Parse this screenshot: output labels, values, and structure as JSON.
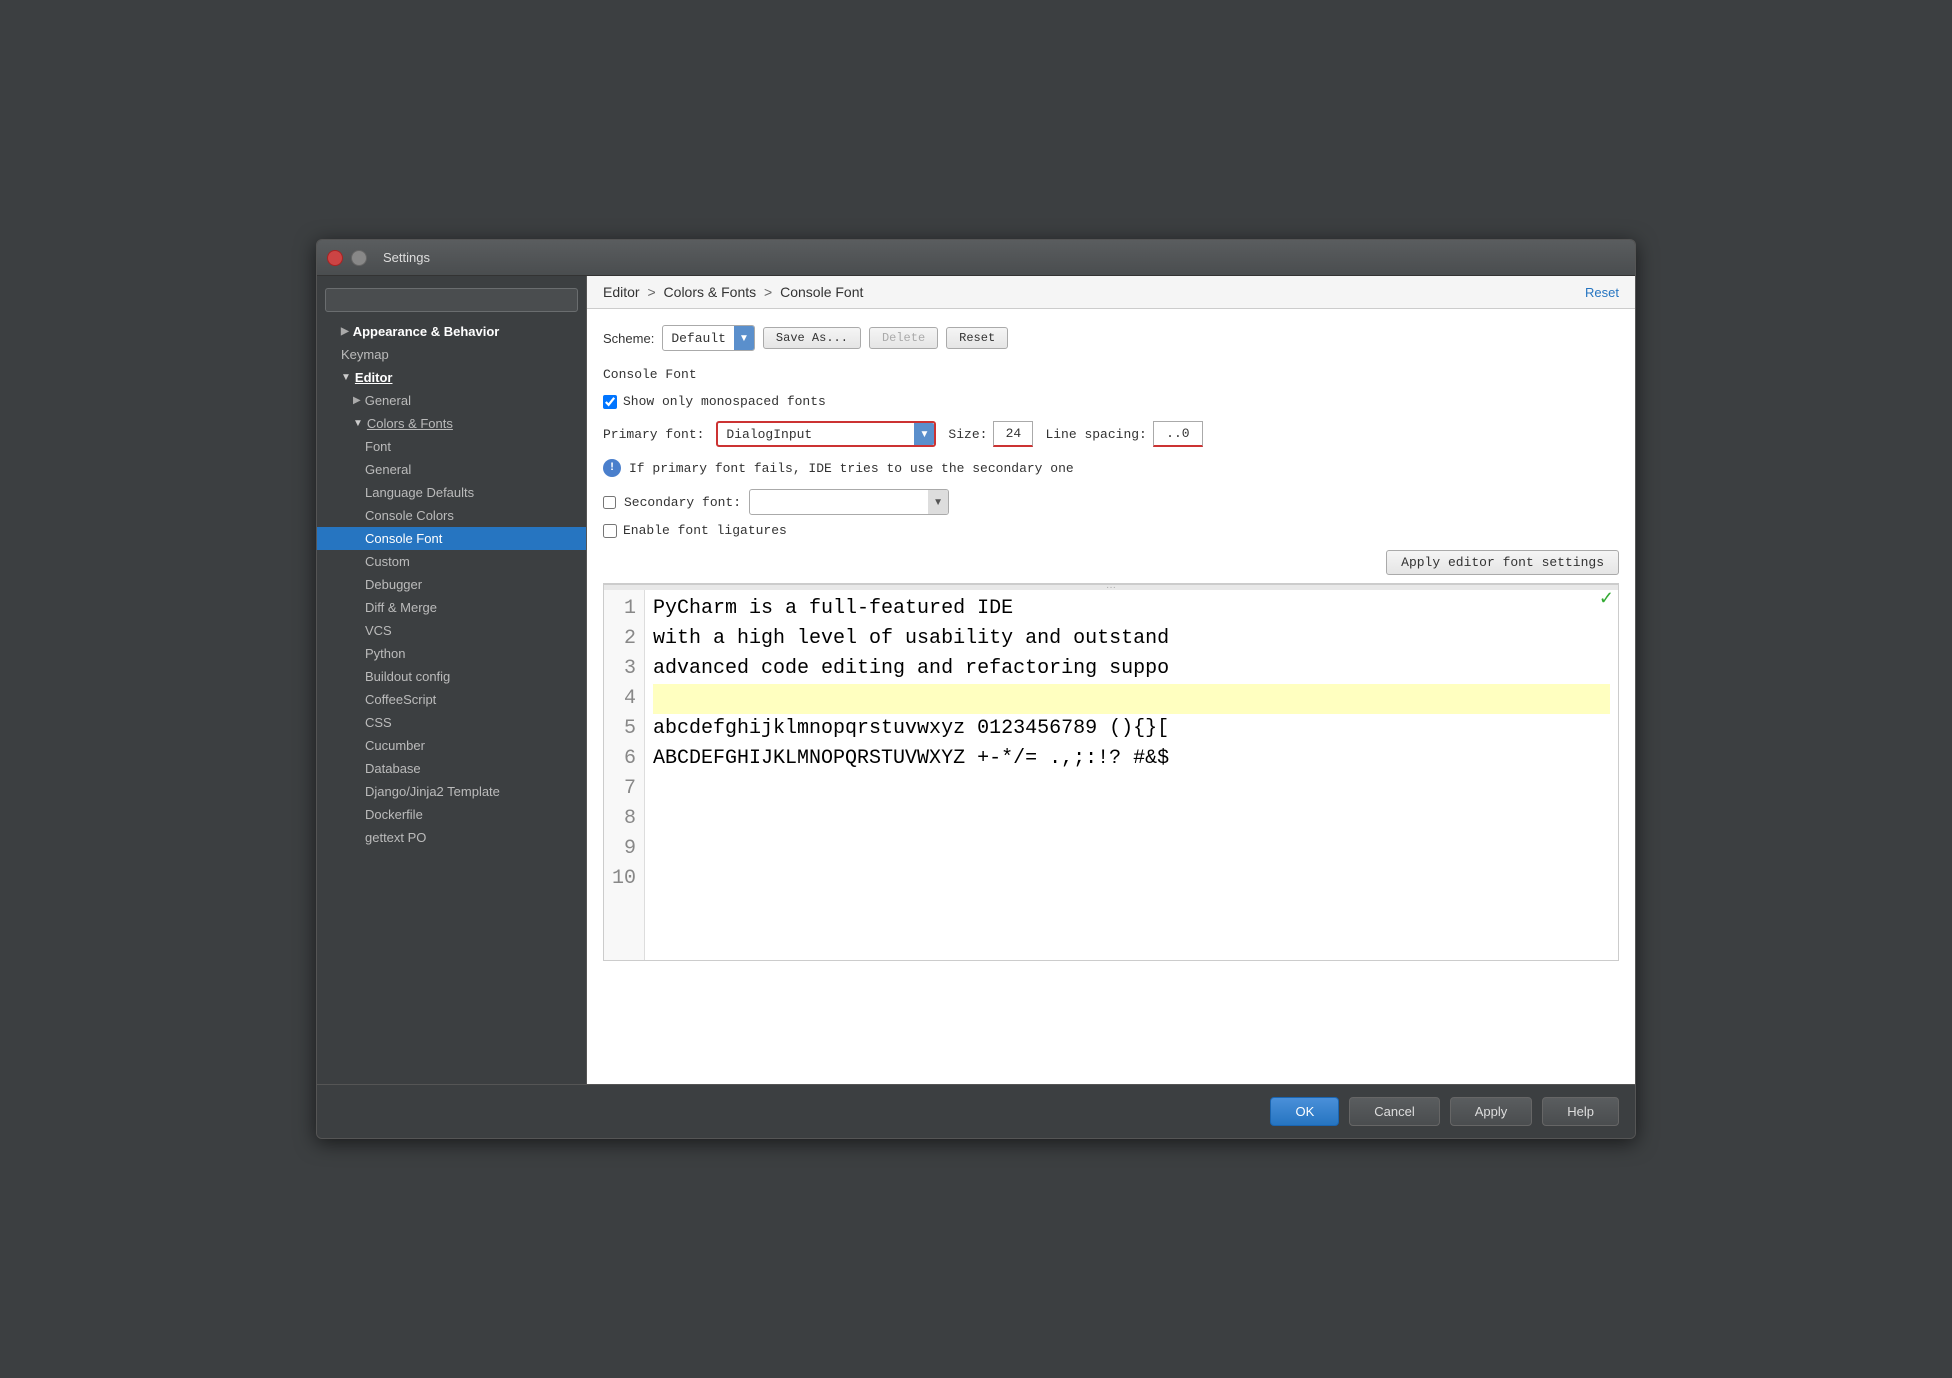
{
  "window": {
    "title": "Settings"
  },
  "breadcrumb": {
    "part1": "Editor",
    "sep1": " > ",
    "part2": "Colors & Fonts",
    "sep2": " > ",
    "part3": "Console Font"
  },
  "header_reset": "Reset",
  "scheme": {
    "label": "Scheme:",
    "value": "Default",
    "buttons": [
      "Save As...",
      "Delete",
      "Reset"
    ]
  },
  "section": {
    "title": "Console Font"
  },
  "monospaced_checkbox": {
    "label": "Show only monospaced fonts",
    "checked": true
  },
  "font": {
    "primary_label": "Primary font:",
    "primary_value": "DialogInput",
    "size_label": "Size:",
    "size_value": "24",
    "linespacing_label": "Line spacing:",
    "linespacing_value": "..0"
  },
  "info_text": "If primary font fails, IDE tries to use the secondary one",
  "secondary": {
    "label": "Secondary font:",
    "value": "",
    "checked": false
  },
  "ligatures": {
    "label": "Enable font ligatures",
    "checked": false
  },
  "apply_editor_btn": "Apply editor font settings",
  "preview": {
    "lines": [
      {
        "num": "1",
        "text": "PyCharm is a full-featured IDE",
        "highlight": false
      },
      {
        "num": "2",
        "text": "with a high level of usability and outstand",
        "highlight": false
      },
      {
        "num": "3",
        "text": "advanced code editing and refactoring suppo",
        "highlight": false
      },
      {
        "num": "4",
        "text": "",
        "highlight": true
      },
      {
        "num": "5",
        "text": "abcdefghijklmnopqrstuvwxyz 0123456789 (){}[",
        "highlight": false
      },
      {
        "num": "6",
        "text": "ABCDEFGHIJKLMNOPQRSTUVWXYZ +-*/= .,;:!? #&$",
        "highlight": false
      },
      {
        "num": "7",
        "text": "",
        "highlight": false
      },
      {
        "num": "8",
        "text": "",
        "highlight": false
      },
      {
        "num": "9",
        "text": "",
        "highlight": false
      },
      {
        "num": "10",
        "text": "",
        "highlight": false
      }
    ]
  },
  "sidebar": {
    "search_placeholder": "",
    "items": [
      {
        "label": "Appearance & Behavior",
        "level": 1,
        "bold": true,
        "triangle": "▶"
      },
      {
        "label": "Keymap",
        "level": 1,
        "bold": false
      },
      {
        "label": "Editor",
        "level": 1,
        "bold": true,
        "triangle": "▼",
        "underline": true
      },
      {
        "label": "General",
        "level": 2,
        "triangle": "▶"
      },
      {
        "label": "Colors & Fonts",
        "level": 2,
        "triangle": "▼",
        "underline": true
      },
      {
        "label": "Font",
        "level": 3
      },
      {
        "label": "General",
        "level": 3
      },
      {
        "label": "Language Defaults",
        "level": 3
      },
      {
        "label": "Console Colors",
        "level": 3
      },
      {
        "label": "Console Font",
        "level": 3,
        "active": true
      },
      {
        "label": "Custom",
        "level": 3
      },
      {
        "label": "Debugger",
        "level": 3
      },
      {
        "label": "Diff & Merge",
        "level": 3
      },
      {
        "label": "VCS",
        "level": 3
      },
      {
        "label": "Python",
        "level": 3
      },
      {
        "label": "Buildout config",
        "level": 3
      },
      {
        "label": "CoffeeScript",
        "level": 3
      },
      {
        "label": "CSS",
        "level": 3
      },
      {
        "label": "Cucumber",
        "level": 3
      },
      {
        "label": "Database",
        "level": 3
      },
      {
        "label": "Django/Jinja2 Template",
        "level": 3
      },
      {
        "label": "Dockerfile",
        "level": 3
      },
      {
        "label": "gettext PO",
        "level": 3
      }
    ]
  },
  "buttons": {
    "ok": "OK",
    "cancel": "Cancel",
    "apply": "Apply",
    "help": "Help"
  }
}
